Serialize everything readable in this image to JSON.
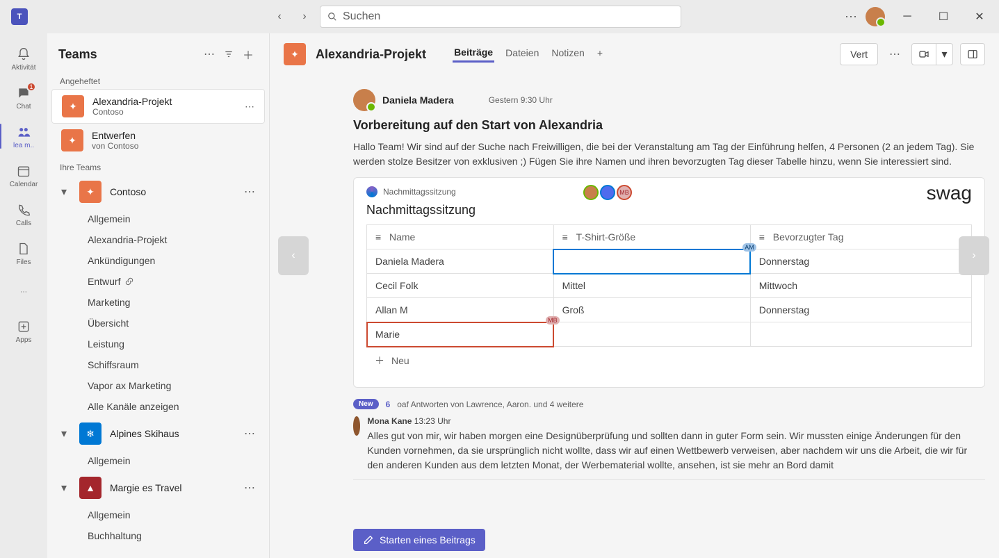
{
  "search": {
    "placeholder": "Suchen"
  },
  "rail": {
    "activity": "Aktivität",
    "chat": "Chat",
    "chat_badge": "1",
    "teams": "lea m..",
    "calendar": "Calendar",
    "calls": "Calls",
    "files": "Files",
    "more": "",
    "apps": "Apps"
  },
  "sidebar": {
    "title": "Teams",
    "pinned_label": "Angeheftet",
    "pinned": [
      {
        "name": "Alexandria-Projekt",
        "sub": "Contoso"
      },
      {
        "name": "Entwerfen",
        "sub": "von Contoso"
      }
    ],
    "yourteams_label": "Ihre Teams",
    "team1": {
      "name": "Contoso"
    },
    "channels1": [
      "Allgemein",
      "Alexandria-Projekt",
      "Ankündigungen",
      "Entwurf",
      "Marketing",
      "Übersicht",
      "Leistung",
      "Schiffsraum",
      "Vapor ax Marketing",
      "Alle Kanäle anzeigen"
    ],
    "team2": {
      "name": "Alpines Skihaus"
    },
    "channels2": [
      "Allgemein"
    ],
    "team3": {
      "name": "Margie es Travel"
    },
    "channels3": [
      "Allgemein",
      "Buchhaltung"
    ]
  },
  "header": {
    "title": "Alexandria-Projekt",
    "tabs": [
      "Beiträge",
      "Dateien",
      "Notizen",
      "+"
    ],
    "vert_btn": "Vert"
  },
  "post": {
    "author": "Daniela Madera",
    "time": "Gestern 9:30 Uhr",
    "title": "Vorbereitung auf den Start von Alexandria",
    "body1": "Hallo Team! Wir sind auf der Suche nach Freiwilligen, die bei der Veranstaltung am Tag der Einführung helfen, 4 Personen (2 an jedem Tag). Sie werden stolze Besitzer von exklusiven ;)",
    "body2": "Fügen Sie ihre Namen und ihren bevorzugten Tag dieser Tabelle hinzu, wenn Sie interessiert sind."
  },
  "loop": {
    "tab": "Nachmittagssitzung",
    "swag": "swag",
    "title": "Nachmittagssitzung",
    "cols": [
      "Name",
      "T-Shirt-Größe",
      "Bevorzugter Tag"
    ],
    "rows": [
      {
        "name": "Daniela Madera",
        "size": "",
        "day": "Donnerstag"
      },
      {
        "name": "Cecil Folk",
        "size": "Mittel",
        "day": "Mittwoch"
      },
      {
        "name": "Allan M",
        "size": "Groß",
        "day": "Donnerstag"
      },
      {
        "name": "Marie",
        "size": "",
        "day": ""
      }
    ],
    "badge_am": "AM",
    "badge_mb": "MB",
    "add": "Neu"
  },
  "replies": {
    "new": "New",
    "count": "6",
    "text": "oaf Antworten von Lawrence, Aaron. und 4 weitere"
  },
  "reply1": {
    "author": "Mona Kane",
    "time": "13:23 Uhr",
    "body": "Alles gut von mir, wir haben morgen eine Designüberprüfung und sollten dann in guter Form sein. Wir mussten einige Änderungen für den Kunden vornehmen, da sie ursprünglich nicht wollte, dass wir auf einen Wettbewerb verweisen, aber nachdem wir uns die Arbeit, die wir für den anderen Kunden aus dem letzten Monat, der Werbematerial wollte, ansehen, ist sie mehr an Bord damit"
  },
  "compose": "Starten eines Beitrags"
}
